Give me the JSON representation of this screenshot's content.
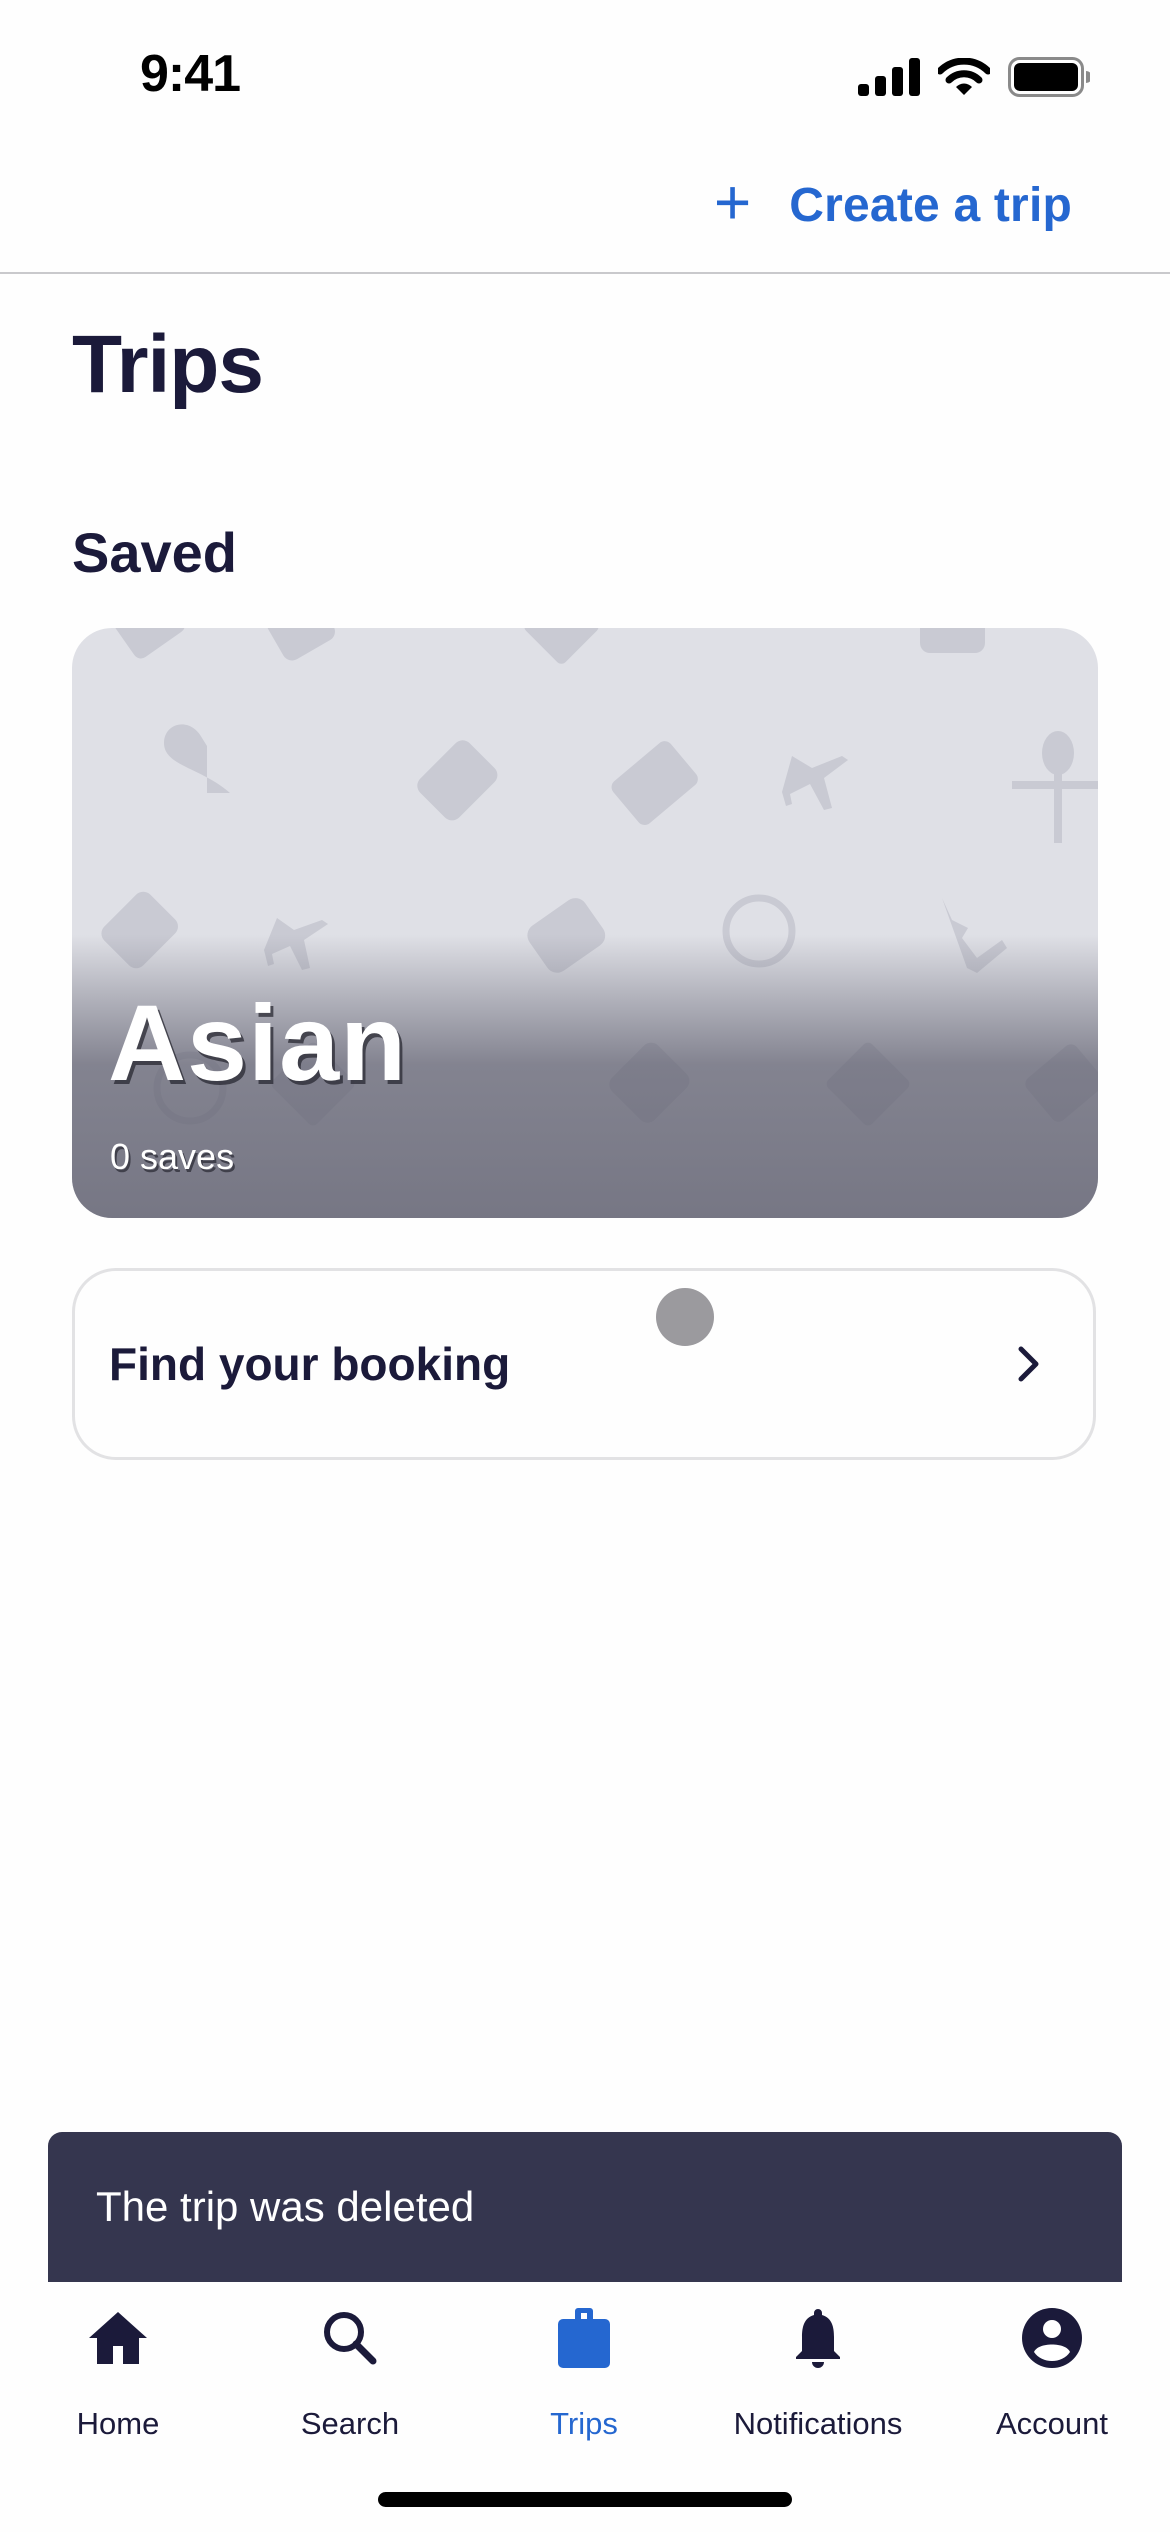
{
  "status_bar": {
    "time": "9:41",
    "icons": [
      "cellular-signal-icon",
      "wifi-icon",
      "battery-icon"
    ]
  },
  "header": {
    "create_icon": "plus-icon",
    "create_label": "Create a trip"
  },
  "page": {
    "title": "Trips",
    "section_title": "Saved"
  },
  "saved_trips": [
    {
      "name": "Asian",
      "saves": "0 saves",
      "pattern_icons": [
        "ticket-icon",
        "heart-icon",
        "plane-icon",
        "car-icon",
        "smiley-icon",
        "palm-tree-icon",
        "hotel-icon",
        "luggage-icon",
        "cutlery-icon"
      ]
    }
  ],
  "booking": {
    "label": "Find your booking",
    "icon": "chevron-right-icon"
  },
  "toast": {
    "message": "The trip was deleted"
  },
  "tab_bar": {
    "items": [
      {
        "label": "Home",
        "icon": "home-icon",
        "active": false
      },
      {
        "label": "Search",
        "icon": "search-icon",
        "active": false
      },
      {
        "label": "Trips",
        "icon": "briefcase-icon",
        "active": true
      },
      {
        "label": "Notifications",
        "icon": "bell-icon",
        "active": false
      },
      {
        "label": "Account",
        "icon": "account-icon",
        "active": false
      }
    ]
  },
  "colors": {
    "accent": "#2567d0",
    "text": "#1b1a3a",
    "toast_bg": "#35364f",
    "card_bg": "#dfe0e6"
  }
}
